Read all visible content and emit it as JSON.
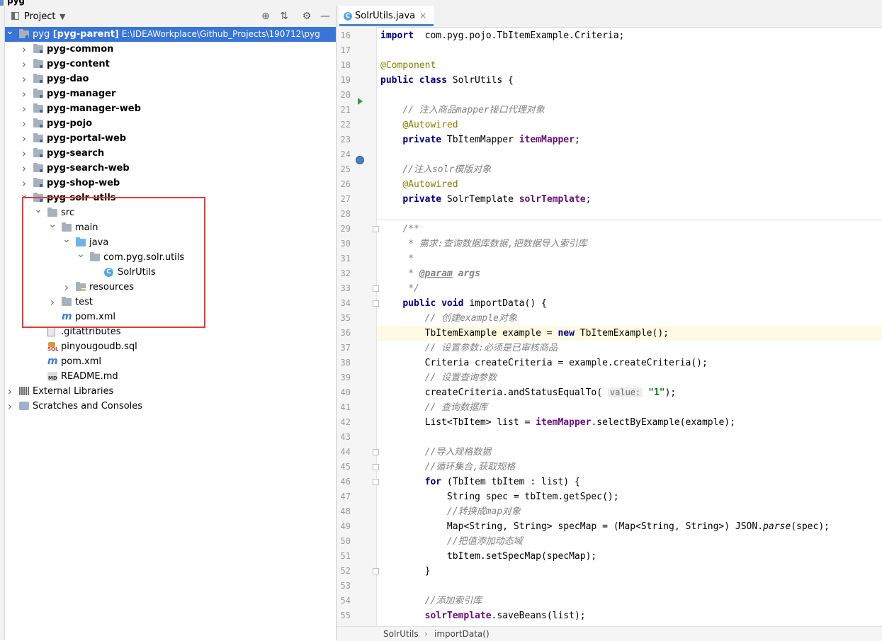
{
  "window": {
    "title": "pyg"
  },
  "project": {
    "header_label": "Project",
    "tree": [
      {
        "id": "root",
        "level": 0,
        "arrow": "down",
        "icon": "module-folder-icon",
        "text": "pyg",
        "bold_suffix": "[pyg-parent]",
        "path": "E:\\IDEAWorkplace\\Github_Projects\\190712\\pyg",
        "selected": true
      },
      {
        "level": 1,
        "arrow": "right",
        "icon": "module-folder-icon",
        "text": "pyg-common",
        "bold": true
      },
      {
        "level": 1,
        "arrow": "right",
        "icon": "module-folder-icon",
        "text": "pyg-content",
        "bold": true
      },
      {
        "level": 1,
        "arrow": "right",
        "icon": "module-folder-icon",
        "text": "pyg-dao",
        "bold": true
      },
      {
        "level": 1,
        "arrow": "right",
        "icon": "module-folder-icon",
        "text": "pyg-manager",
        "bold": true
      },
      {
        "level": 1,
        "arrow": "right",
        "icon": "module-folder-icon",
        "text": "pyg-manager-web",
        "bold": true
      },
      {
        "level": 1,
        "arrow": "right",
        "icon": "module-folder-icon",
        "text": "pyg-pojo",
        "bold": true
      },
      {
        "level": 1,
        "arrow": "right",
        "icon": "module-folder-icon",
        "text": "pyg-portal-web",
        "bold": true
      },
      {
        "level": 1,
        "arrow": "right",
        "icon": "module-folder-icon",
        "text": "pyg-search",
        "bold": true
      },
      {
        "level": 1,
        "arrow": "right",
        "icon": "module-folder-icon",
        "text": "pyg-search-web",
        "bold": true
      },
      {
        "level": 1,
        "arrow": "right",
        "icon": "module-folder-icon",
        "text": "pyg-shop-web",
        "bold": true
      },
      {
        "level": 1,
        "arrow": "down",
        "icon": "module-folder-icon",
        "text": "pyg-solr-utils",
        "bold": true
      },
      {
        "level": 2,
        "arrow": "down",
        "icon": "folder-icon",
        "text": "src"
      },
      {
        "level": 3,
        "arrow": "down",
        "icon": "folder-icon",
        "text": "main"
      },
      {
        "level": 4,
        "arrow": "down",
        "icon": "source-folder-icon",
        "text": "java"
      },
      {
        "level": 5,
        "arrow": "down",
        "icon": "package-icon",
        "text": "com.pyg.solr.utils"
      },
      {
        "level": 6,
        "arrow": "none",
        "icon": "java-class-icon",
        "text": "SolrUtils"
      },
      {
        "level": 4,
        "arrow": "right",
        "icon": "resources-folder-icon",
        "text": "resources"
      },
      {
        "level": 3,
        "arrow": "right",
        "icon": "folder-icon",
        "text": "test"
      },
      {
        "level": 3,
        "arrow": "none",
        "icon": "maven-icon",
        "text": "pom.xml"
      },
      {
        "level": 2,
        "arrow": "none",
        "icon": "text-file-icon",
        "text": ".gitattributes"
      },
      {
        "level": 2,
        "arrow": "none",
        "icon": "sql-file-icon",
        "text": "pinyougoudb.sql"
      },
      {
        "level": 2,
        "arrow": "none",
        "icon": "maven-icon",
        "text": "pom.xml"
      },
      {
        "level": 2,
        "arrow": "none",
        "icon": "markdown-file-icon",
        "text": "README.md"
      },
      {
        "level": 0,
        "arrow": "right",
        "icon": "libraries-icon",
        "text": "External Libraries"
      },
      {
        "level": 0,
        "arrow": "right",
        "icon": "scratches-icon",
        "text": "Scratches and Consoles"
      }
    ]
  },
  "editor": {
    "tab": {
      "label": "SolrUtils.java",
      "close": "×"
    },
    "lines": [
      {
        "n": 16,
        "segs": [
          [
            "kw",
            "import"
          ],
          [
            "",
            "  com.pyg.pojo.TbItemExample.Criteria;"
          ]
        ]
      },
      {
        "n": 17,
        "segs": []
      },
      {
        "n": 18,
        "segs": [
          [
            "an",
            "@Component"
          ]
        ]
      },
      {
        "n": 19,
        "segs": [
          [
            "kw",
            "public class"
          ],
          [
            "",
            " SolrUtils {"
          ]
        ]
      },
      {
        "n": 20,
        "segs": []
      },
      {
        "n": 21,
        "segs": [
          [
            "",
            "    "
          ],
          [
            "cm",
            "// 注入商品mapper接口代理对象"
          ]
        ]
      },
      {
        "n": 22,
        "segs": [
          [
            "",
            "    "
          ],
          [
            "an",
            "@Autowired"
          ]
        ]
      },
      {
        "n": 23,
        "segs": [
          [
            "",
            "    "
          ],
          [
            "kw",
            "private"
          ],
          [
            "",
            " TbItemMapper "
          ],
          [
            "fd",
            "itemMapper"
          ],
          [
            "",
            ";"
          ]
        ]
      },
      {
        "n": 24,
        "segs": []
      },
      {
        "n": 25,
        "segs": [
          [
            "",
            "    "
          ],
          [
            "cm",
            "//注入solr模版对象"
          ]
        ]
      },
      {
        "n": 26,
        "segs": [
          [
            "",
            "    "
          ],
          [
            "an",
            "@Autowired"
          ]
        ]
      },
      {
        "n": 27,
        "segs": [
          [
            "",
            "    "
          ],
          [
            "kw",
            "private"
          ],
          [
            "",
            " SolrTemplate "
          ],
          [
            "fd",
            "solrTemplate"
          ],
          [
            "",
            ";"
          ]
        ]
      },
      {
        "n": 28,
        "segs": []
      },
      {
        "n": 29,
        "segs": [
          [
            "",
            "    "
          ],
          [
            "cm",
            "/**"
          ]
        ]
      },
      {
        "n": 30,
        "segs": [
          [
            "",
            "     "
          ],
          [
            "cm",
            "* 需求:查询数据库数据,把数据导入索引库"
          ]
        ]
      },
      {
        "n": 31,
        "segs": [
          [
            "",
            "     "
          ],
          [
            "cm",
            "*"
          ]
        ]
      },
      {
        "n": 32,
        "segs": [
          [
            "",
            "     "
          ],
          [
            "cm",
            "* "
          ],
          [
            "jd",
            "@param"
          ],
          [
            "cm",
            " "
          ],
          [
            "cmb",
            "args"
          ]
        ]
      },
      {
        "n": 33,
        "segs": [
          [
            "",
            "     "
          ],
          [
            "cm",
            "*/"
          ]
        ]
      },
      {
        "n": 34,
        "segs": [
          [
            "",
            "    "
          ],
          [
            "kw",
            "public void"
          ],
          [
            "",
            " importData() {"
          ]
        ]
      },
      {
        "n": 35,
        "segs": [
          [
            "",
            "        "
          ],
          [
            "cm",
            "// 创建example对象"
          ]
        ]
      },
      {
        "n": 36,
        "segs": [
          [
            "",
            "        TbItemExample example = "
          ],
          [
            "kw",
            "new"
          ],
          [
            "",
            " TbItemExample();"
          ]
        ],
        "current": true
      },
      {
        "n": 37,
        "segs": [
          [
            "",
            "        "
          ],
          [
            "cm",
            "// 设置参数:必须是已审核商品"
          ]
        ]
      },
      {
        "n": 38,
        "segs": [
          [
            "",
            "        Criteria createCriteria = example.createCriteria();"
          ]
        ]
      },
      {
        "n": 39,
        "segs": [
          [
            "",
            "        "
          ],
          [
            "cm",
            "// 设置查询参数"
          ]
        ]
      },
      {
        "n": 40,
        "segs": [
          [
            "",
            "        createCriteria.andStatusEqualTo( "
          ],
          [
            "hint",
            "value:"
          ],
          [
            "",
            " "
          ],
          [
            "st",
            "\"1\""
          ],
          [
            "",
            ");"
          ]
        ]
      },
      {
        "n": 41,
        "segs": [
          [
            "",
            "        "
          ],
          [
            "cm",
            "// 查询数据库"
          ]
        ]
      },
      {
        "n": 42,
        "segs": [
          [
            "",
            "        List<TbItem> list = "
          ],
          [
            "fd",
            "itemMapper"
          ],
          [
            "",
            ".selectByExample(example);"
          ]
        ]
      },
      {
        "n": 43,
        "segs": []
      },
      {
        "n": 44,
        "segs": [
          [
            "",
            "        "
          ],
          [
            "cm",
            "//导入规格数据"
          ]
        ]
      },
      {
        "n": 45,
        "segs": [
          [
            "",
            "        "
          ],
          [
            "cm",
            "//循环集合,获取规格"
          ]
        ]
      },
      {
        "n": 46,
        "segs": [
          [
            "",
            "        "
          ],
          [
            "kw",
            "for"
          ],
          [
            "",
            " (TbItem tbItem : list) {"
          ]
        ]
      },
      {
        "n": 47,
        "segs": [
          [
            "",
            "            String spec = tbItem.getSpec();"
          ]
        ]
      },
      {
        "n": 48,
        "segs": [
          [
            "",
            "            "
          ],
          [
            "cm",
            "//转换成map对象"
          ]
        ]
      },
      {
        "n": 49,
        "segs": [
          [
            "",
            "            Map<String, String> specMap = (Map<String, String>) JSON."
          ],
          [
            "it",
            "parse"
          ],
          [
            "",
            "(spec);"
          ]
        ]
      },
      {
        "n": 50,
        "segs": [
          [
            "",
            "            "
          ],
          [
            "cm",
            "//把值添加动态域"
          ]
        ]
      },
      {
        "n": 51,
        "segs": [
          [
            "",
            "            tbItem.setSpecMap(specMap);"
          ]
        ]
      },
      {
        "n": 52,
        "segs": [
          [
            "",
            "        }"
          ]
        ]
      },
      {
        "n": 53,
        "segs": []
      },
      {
        "n": 54,
        "segs": [
          [
            "",
            "        "
          ],
          [
            "cm",
            "//添加索引库"
          ]
        ]
      },
      {
        "n": 55,
        "segs": [
          [
            "",
            "        "
          ],
          [
            "fd",
            "solrTemplate"
          ],
          [
            "",
            ".saveBeans(list);"
          ]
        ]
      }
    ],
    "breadcrumb": {
      "cls": "SolrUtils",
      "sep": "›",
      "method": "importData()"
    }
  },
  "colors": {
    "selection": "#3875d7",
    "highlight_box": "#e53935",
    "keyword": "#000080",
    "annotation": "#808000",
    "comment": "#808080",
    "field": "#660e7a",
    "string": "#008000"
  }
}
